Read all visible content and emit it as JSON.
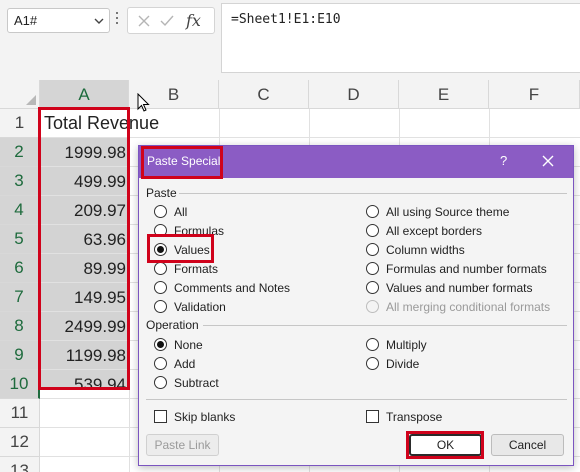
{
  "formula_bar": {
    "name_box": "A1#",
    "formula": "=Sheet1!E1:E10",
    "fx_label": "fx",
    "icons": [
      "chevron-down-icon",
      "cancel-icon",
      "enter-check-icon"
    ]
  },
  "columns": [
    "A",
    "B",
    "C",
    "D",
    "E",
    "F"
  ],
  "rows": [
    "1",
    "2",
    "3",
    "4",
    "5",
    "6",
    "7",
    "8",
    "9",
    "10",
    "11",
    "12",
    "13"
  ],
  "cells": {
    "a1": "Total Revenue",
    "a_values": [
      "1999.98",
      "499.99",
      "209.97",
      "63.96",
      "89.99",
      "149.95",
      "2499.99",
      "1199.98",
      "539.94"
    ]
  },
  "dialog": {
    "title": "Paste Special",
    "help": "?",
    "paste_section": "Paste",
    "paste_left": [
      "All",
      "Formulas",
      "Values",
      "Formats",
      "Comments and Notes",
      "Validation"
    ],
    "paste_right": [
      "All using Source theme",
      "All except borders",
      "Column widths",
      "Formulas and number formats",
      "Values and number formats",
      "All merging conditional formats"
    ],
    "selected_paste": "Values",
    "operation_section": "Operation",
    "operation_left": [
      "None",
      "Add",
      "Subtract"
    ],
    "operation_right": [
      "Multiply",
      "Divide"
    ],
    "selected_operation": "None",
    "skip_blanks": "Skip blanks",
    "transpose": "Transpose",
    "paste_link": "Paste Link",
    "ok": "OK",
    "cancel": "Cancel"
  },
  "colors": {
    "title_bar": "#8b5cc4",
    "excel_green": "#1e6b3d",
    "highlight": "#d0021b"
  }
}
